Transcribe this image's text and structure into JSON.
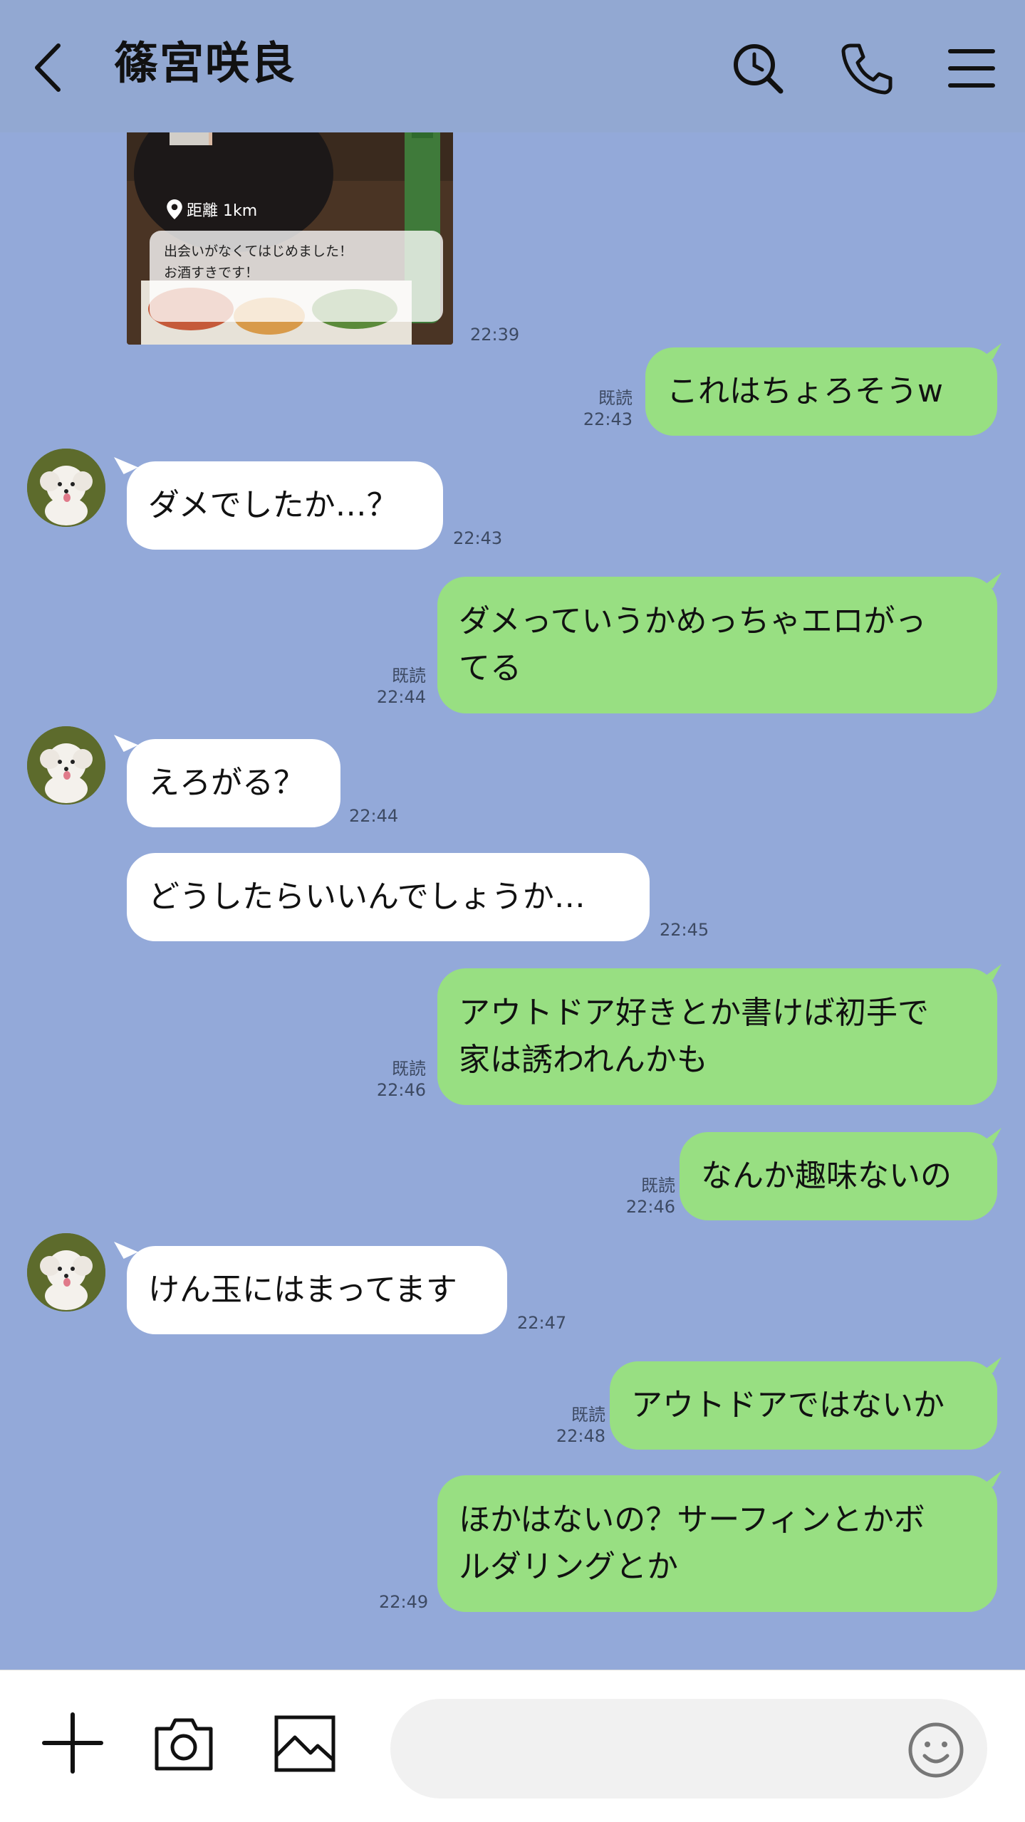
{
  "header": {
    "title": "篠宮咲良"
  },
  "photo": {
    "location": "距離 1km",
    "caption_line1": "出会いがなくてはじめました！",
    "caption_line2": "お酒すきです！",
    "time": "22:39"
  },
  "messages": [
    {
      "text": "これはちょろそうw",
      "time": "22:43",
      "read": "既読"
    },
    {
      "text": "ダメでしたか…？",
      "time": "22:43"
    },
    {
      "text": "ダメっていうかめっちゃエロがっ\nてる",
      "time": "22:44",
      "read": "既読"
    },
    {
      "text": "えろがる？",
      "time": "22:44"
    },
    {
      "text": "どうしたらいいんでしょうか…",
      "time": "22:45"
    },
    {
      "text": "アウトドア好きとか書けば初手で\n家は誘われんかも",
      "time": "22:46",
      "read": "既読"
    },
    {
      "text": "なんか趣味ないの",
      "time": "22:46",
      "read": "既読"
    },
    {
      "text": "けん玉にはまってます",
      "time": "22:47"
    },
    {
      "text": "アウトドアではないか",
      "time": "22:48",
      "read": "既読"
    },
    {
      "text": "ほかはないの？サーフィンとかボ\nルダリングとか",
      "time": "22:49"
    }
  ],
  "footer": {
    "input_placeholder": ""
  },
  "icons": {
    "back": "chevron-left-icon",
    "search": "search-icon",
    "call": "phone-icon",
    "menu": "menu-icon",
    "add": "plus-icon",
    "camera": "camera-icon",
    "image": "image-icon",
    "emoji": "emoji-icon"
  },
  "colors": {
    "background": "#93a9d9",
    "outgoing_bubble": "#98df82",
    "incoming_bubble": "#ffffff"
  }
}
